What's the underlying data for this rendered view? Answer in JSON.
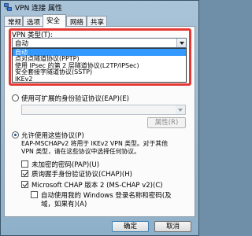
{
  "window": {
    "title": "VPN 连接 属性"
  },
  "tabs": [
    {
      "label": "常规"
    },
    {
      "label": "选项"
    },
    {
      "label": "安全"
    },
    {
      "label": "网络"
    },
    {
      "label": "共享"
    }
  ],
  "security": {
    "vpn_type_label": "VPN 类型(T):",
    "vpn_type_selected": "自动",
    "vpn_type_options": [
      {
        "label": "自动",
        "selected": true
      },
      {
        "label": "点对点隧道协议(PPTP)",
        "selected": false
      },
      {
        "label": "使用 IPsec 的第 2 层隧道协议(L2TP/IPSec)",
        "selected": false
      },
      {
        "label": "安全套接字隧道协议(SSTP)",
        "selected": false
      },
      {
        "label": "IKEv2",
        "selected": false
      }
    ],
    "eap_radio_label": "使用可扩展的身份验证协议(EAP)(E)",
    "eap_properties_button": "属性(R)",
    "allow_protocols_label": "允许使用这些协议(P)",
    "note_text_line1": "EAP-MSCHAPv2 将用于 IKEv2 VPN 类型。对于其他",
    "note_text_line2": "VPN 类型，请在这些协议中选择任何协议。",
    "protocols": [
      {
        "label": "未加密的密码(PAP)(U)",
        "checked": false
      },
      {
        "label": "质询握手身份验证协议(CHAP)(H)",
        "checked": true
      },
      {
        "label": "Microsoft CHAP 版本 2 (MS-CHAP v2)(C)",
        "checked": true
      }
    ],
    "autologon_line1": "自动使用我的 Windows 登录名称和密码(及",
    "autologon_line2": "域，如果有)(A)",
    "autologon_checked": false
  },
  "footer": {
    "ok_label": "确定",
    "cancel_label": "取消"
  },
  "colors": {
    "selection": "#3399ff",
    "highlight_box": "#e53935"
  }
}
